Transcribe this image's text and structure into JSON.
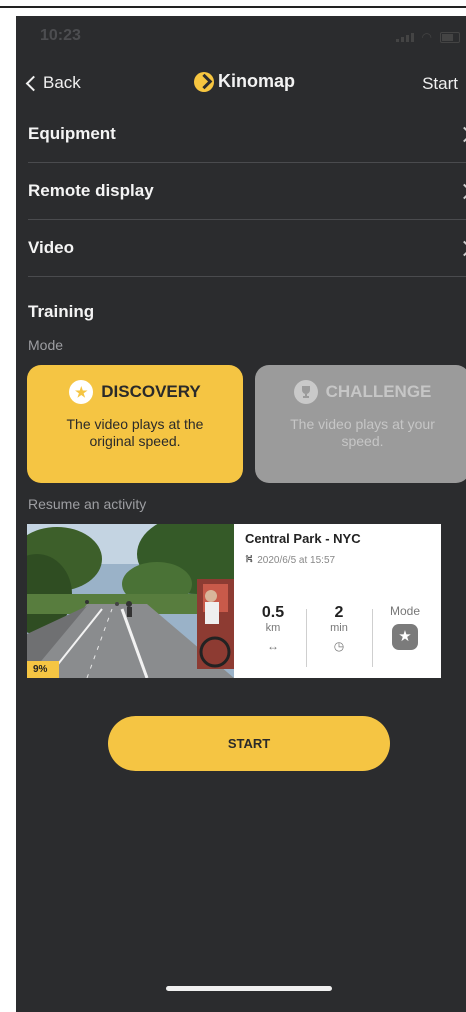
{
  "status_bar": {
    "time": "10:23"
  },
  "nav": {
    "back_label": "Back",
    "brand": "Kinomap",
    "start_label": "Start"
  },
  "menu": {
    "items": [
      {
        "label": "Equipment"
      },
      {
        "label": "Remote display"
      },
      {
        "label": "Video"
      }
    ]
  },
  "training": {
    "title": "Training",
    "mode_label": "Mode",
    "modes": [
      {
        "title": "DISCOVERY",
        "description": "The video plays at the original speed.",
        "selected": true
      },
      {
        "title": "CHALLENGE",
        "description": "The video plays at your speed.",
        "selected": false
      }
    ]
  },
  "resume": {
    "label": "Resume an activity",
    "activity": {
      "title": "Central Park - NYC",
      "date": "2020/6/5 at 15:57",
      "progress": "9%",
      "distance_value": "0.5",
      "distance_unit": "km",
      "time_value": "2",
      "time_unit": "min",
      "mode_label": "Mode"
    }
  },
  "start_button": "START",
  "icons": {
    "back": "chevron-left-icon",
    "logo": "kinomap-logo-icon",
    "menu_chevron": "chevron-right-icon",
    "discovery": "star-icon",
    "challenge": "trophy-icon",
    "distance": "arrows-horizontal-icon",
    "time": "clock-icon",
    "mode": "star-icon",
    "date": "cyclist-icon"
  },
  "colors": {
    "accent": "#f5c543",
    "background": "#2b2c2e",
    "disabled_card": "#9b9b9b"
  }
}
